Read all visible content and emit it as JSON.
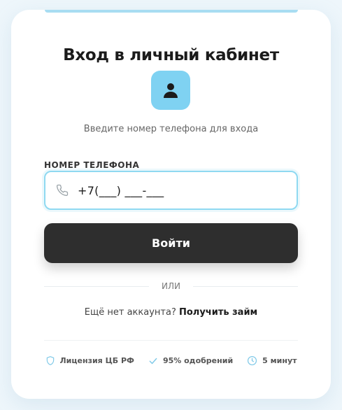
{
  "login": {
    "title": "Вход в личный кабинет",
    "subtitle": "Введите номер телефона для входа",
    "phone_label": "НОМЕР ТЕЛЕФОНА",
    "phone_value": "+7(___) ___-___",
    "submit_label": "Войти",
    "or_label": "ИЛИ",
    "no_account_text": "Ещё нет аккаунта?",
    "signup_link": "Получить займ"
  },
  "features": [
    {
      "icon": "shield-icon",
      "label": "Лицензия ЦБ РФ"
    },
    {
      "icon": "check-icon",
      "label": "95% одобрений"
    },
    {
      "icon": "clock-icon",
      "label": "5 минут"
    }
  ],
  "colors": {
    "accent": "#7fd2f2",
    "button": "#2e2e2e",
    "field_border": "#8fd9f1"
  }
}
